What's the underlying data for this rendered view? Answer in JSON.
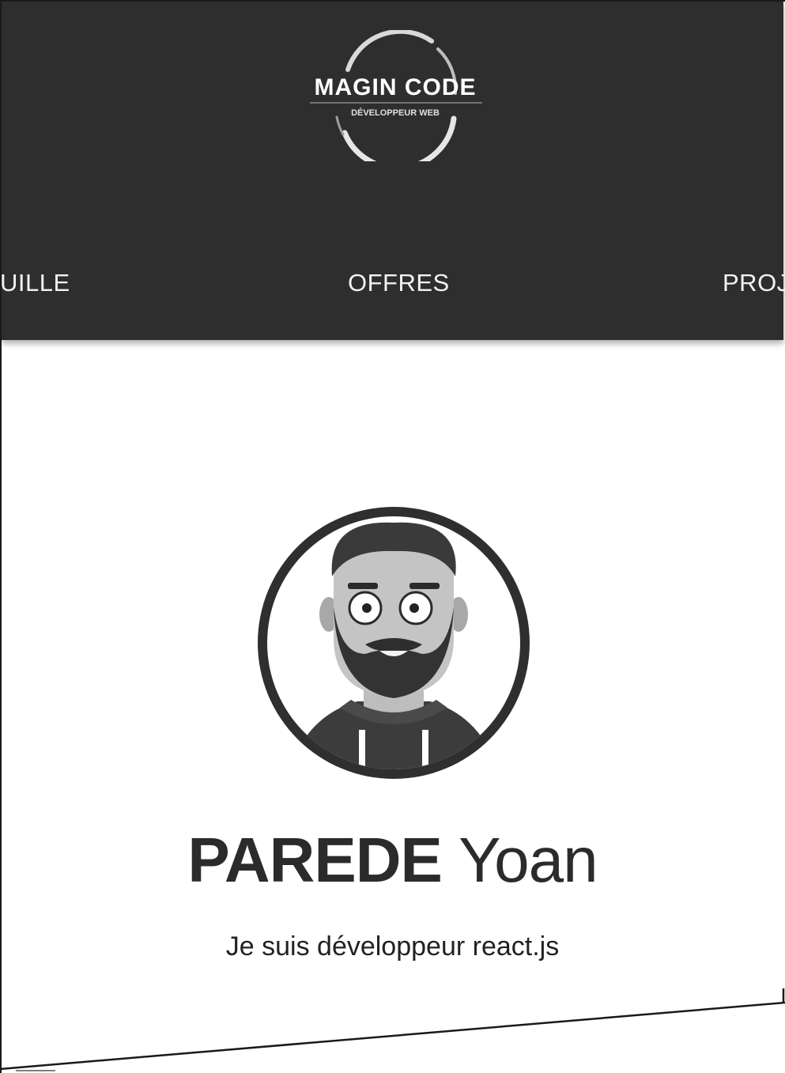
{
  "header": {
    "logo": {
      "title": "MAGIN CODE",
      "subtitle": "DÉVELOPPEUR WEB"
    },
    "nav": {
      "left_label": "UILLE",
      "center_label": "OFFRES",
      "right_label": "PROJ"
    }
  },
  "profile": {
    "avatar_icon": "developer-avatar-icon",
    "last_name": "PAREDE",
    "first_name": "Yoan",
    "tagline": "Je suis développeur react.js"
  },
  "colors": {
    "header_bg": "#2e2e2e",
    "nav_text": "#f2f2f2",
    "name_text": "#2b2b2b",
    "page_bg": "#ffffff"
  }
}
